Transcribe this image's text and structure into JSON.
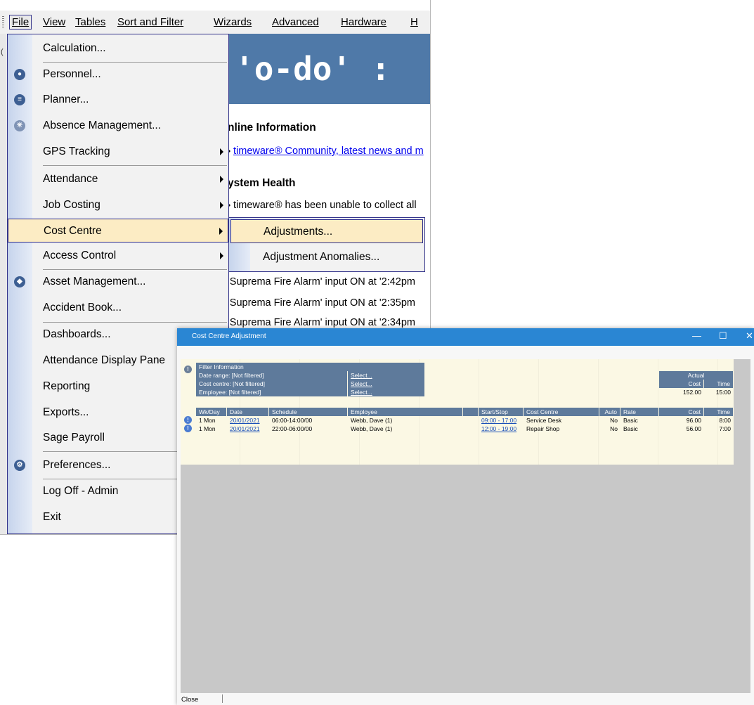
{
  "menubar": {
    "items": [
      "File",
      "View",
      "Tables",
      "Sort and Filter",
      "Wizards",
      "Advanced",
      "Hardware",
      "H"
    ]
  },
  "background": {
    "banner": "'o-do'  :",
    "online_heading": "nline Information",
    "online_link": "timeware® Community, latest news and m",
    "health_heading": "ystem Health",
    "health_text": "timeware® has been unable to collect all",
    "alarms": [
      "'Suprema Fire Alarm' input ON at '2:42pm",
      "'Suprema Fire Alarm' input ON at '2:35pm",
      "'Suprema Fire Alarm' input ON at '2:34pm"
    ],
    "left_strip_text": "("
  },
  "file_menu": {
    "items": [
      {
        "label": "Calculation...",
        "icon": ""
      },
      {
        "label": "Personnel...",
        "icon": "person-icon"
      },
      {
        "label": "Planner...",
        "icon": "planner-icon"
      },
      {
        "label": "Absence Management...",
        "icon": "absence-icon"
      },
      {
        "label": "GPS Tracking",
        "submenu": true
      },
      {
        "label": "Attendance",
        "submenu": true
      },
      {
        "label": "Job Costing",
        "submenu": true
      },
      {
        "label": "Cost Centre",
        "submenu": true,
        "highlighted": true
      },
      {
        "label": "Access Control",
        "submenu": true
      },
      {
        "label": "Asset Management...",
        "icon": "asset-icon"
      },
      {
        "label": "Accident Book..."
      },
      {
        "label": "Dashboards..."
      },
      {
        "label": "Attendance Display Pane"
      },
      {
        "label": "Reporting"
      },
      {
        "label": "Exports..."
      },
      {
        "label": "Sage Payroll"
      },
      {
        "label": "Preferences...",
        "icon": "gear-icon"
      },
      {
        "label": "Log Off - Admin"
      },
      {
        "label": "Exit"
      }
    ]
  },
  "submenu": {
    "items": [
      "Adjustments...",
      "Adjustment Anomalies..."
    ]
  },
  "dialog": {
    "title": "Cost Centre Adjustment",
    "minimize": "—",
    "maximize": "☐",
    "close": "✕",
    "filter": {
      "heading": "Filter Information",
      "rows": [
        {
          "label": "Date range: [Not filtered]",
          "action": "Select..."
        },
        {
          "label": "Cost centre: [Not filtered]",
          "action": "Select..."
        },
        {
          "label": "Employee: [Not filtered]",
          "action": "Select..."
        }
      ]
    },
    "actual": {
      "heading": "Actual",
      "cost_label": "Cost",
      "time_label": "Time",
      "cost_value": "152.00",
      "time_value": "15:00"
    },
    "table": {
      "columns": [
        "Wk/Day",
        "Date",
        "Schedule",
        "Employee",
        "",
        "Start/Stop",
        "Cost Centre",
        "Auto",
        "Rate",
        "Cost",
        "Time"
      ],
      "rows": [
        {
          "wkday": "1 Mon",
          "date": "20/01/2021",
          "schedule": "06:00-14:00/00",
          "employee": "Webb, Dave (1)",
          "startstop": "09:00 - 17:00",
          "centre": "Service Desk",
          "auto": "No",
          "rate": "Basic",
          "cost": "96.00",
          "time": "8:00"
        },
        {
          "wkday": "1 Mon",
          "date": "20/01/2021",
          "schedule": "22:00-06:00/00",
          "employee": "Webb, Dave (1)",
          "startstop": "12:00 - 19:00",
          "centre": "Repair Shop",
          "auto": "No",
          "rate": "Basic",
          "cost": "56.00",
          "time": "7:00"
        }
      ]
    },
    "footer": {
      "close_label": "Close"
    }
  }
}
